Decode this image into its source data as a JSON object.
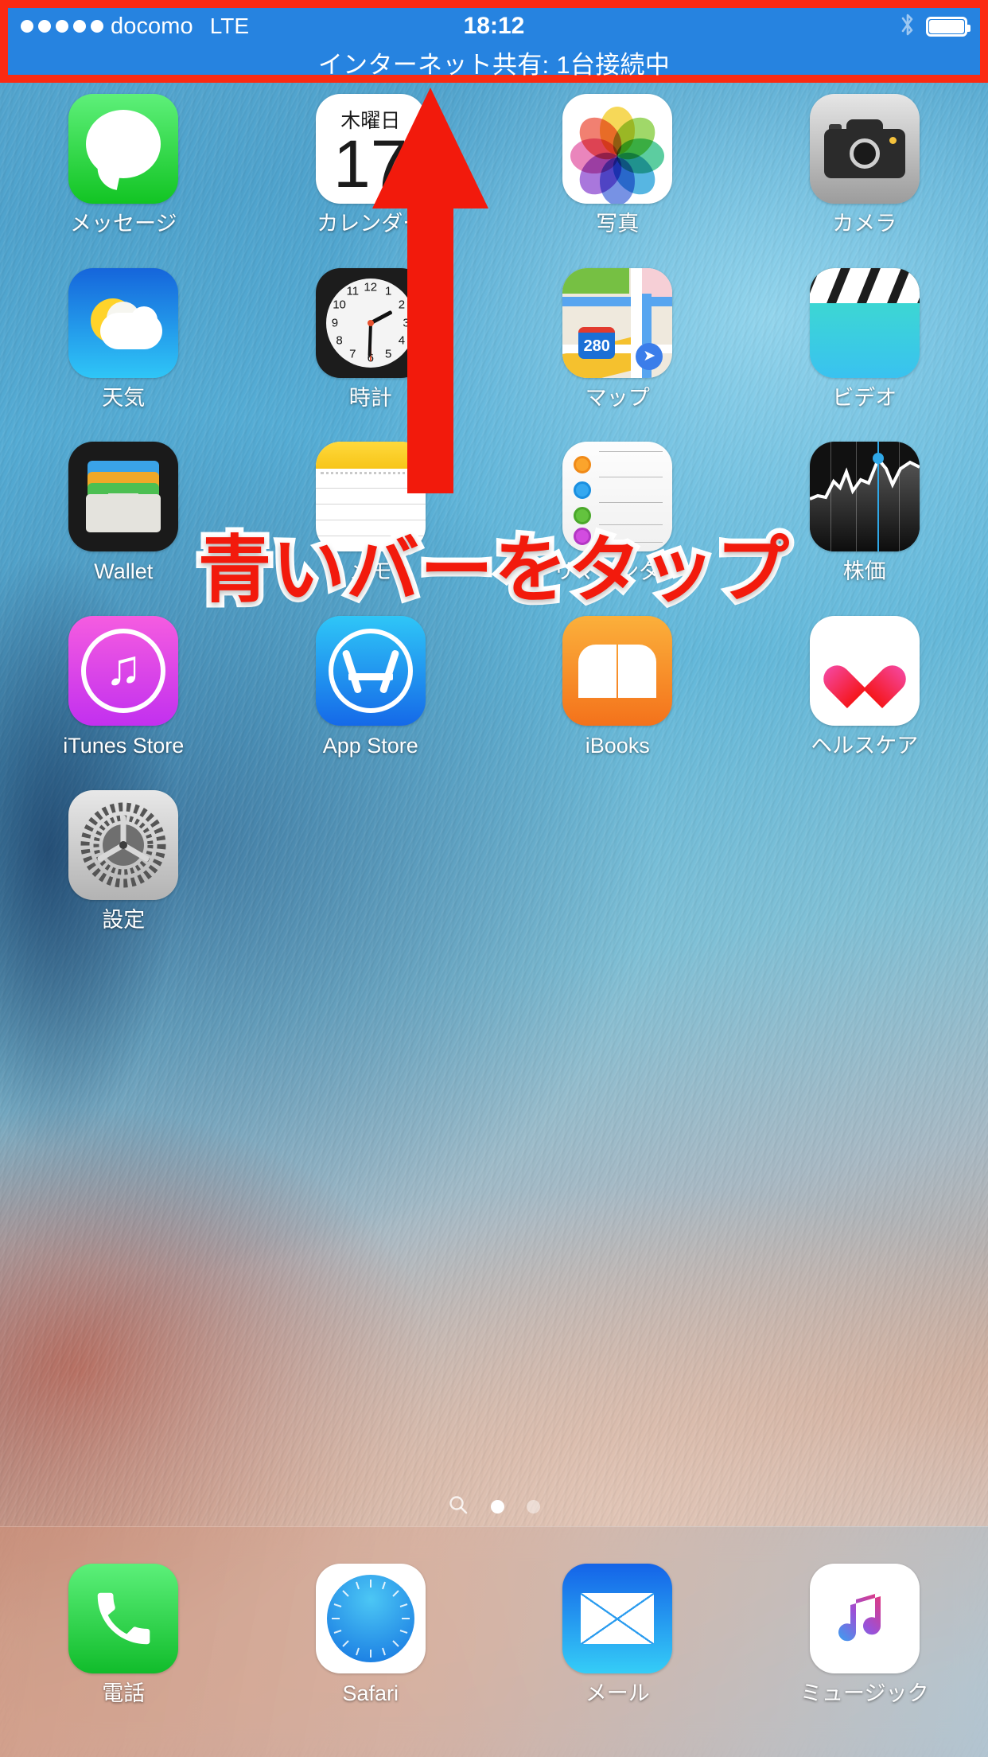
{
  "status_bar": {
    "carrier": "docomo",
    "network": "LTE",
    "signal_dots": 5,
    "time": "18:12",
    "bluetooth_icon": "bluetooth-icon",
    "battery_icon": "battery-full-icon",
    "hotspot_banner": "インターネット共有: 1台接続中",
    "bar_color": "#2683e0",
    "highlight_color": "#fb2a12"
  },
  "annotation": {
    "callout_text": "青いバーをタップ",
    "callout_color": "#f21a0c",
    "callout_outline": "#ffffff",
    "arrow_color": "#f21a0c",
    "arrow_name": "red-up-arrow"
  },
  "home_screen": {
    "rows": [
      [
        {
          "label": "メッセージ",
          "icon": "messages-icon",
          "name": "app-messages"
        },
        {
          "label": "カレンダー",
          "icon": "calendar-icon",
          "name": "app-calendar",
          "calendar_weekday": "木曜日",
          "calendar_day": "17"
        },
        {
          "label": "写真",
          "icon": "photos-icon",
          "name": "app-photos"
        },
        {
          "label": "カメラ",
          "icon": "camera-icon",
          "name": "app-camera"
        }
      ],
      [
        {
          "label": "天気",
          "icon": "weather-icon",
          "name": "app-weather"
        },
        {
          "label": "時計",
          "icon": "clock-icon",
          "name": "app-clock"
        },
        {
          "label": "マップ",
          "icon": "maps-icon",
          "name": "app-maps",
          "map_shield": "280"
        },
        {
          "label": "ビデオ",
          "icon": "videos-icon",
          "name": "app-videos"
        }
      ],
      [
        {
          "label": "Wallet",
          "icon": "wallet-icon",
          "name": "app-wallet"
        },
        {
          "label": "メモ",
          "icon": "notes-icon",
          "name": "app-notes"
        },
        {
          "label": "リマインダー",
          "icon": "reminders-icon",
          "name": "app-reminders"
        },
        {
          "label": "株価",
          "icon": "stocks-icon",
          "name": "app-stocks"
        }
      ],
      [
        {
          "label": "iTunes Store",
          "icon": "itunes-store-icon",
          "name": "app-itunes-store"
        },
        {
          "label": "App Store",
          "icon": "app-store-icon",
          "name": "app-app-store"
        },
        {
          "label": "iBooks",
          "icon": "ibooks-icon",
          "name": "app-ibooks"
        },
        {
          "label": "ヘルスケア",
          "icon": "health-icon",
          "name": "app-health"
        }
      ],
      [
        {
          "label": "設定",
          "icon": "settings-gear-icon",
          "name": "app-settings"
        },
        {
          "label": "",
          "icon": "",
          "name": "empty"
        },
        {
          "label": "",
          "icon": "",
          "name": "empty"
        },
        {
          "label": "",
          "icon": "",
          "name": "empty"
        }
      ]
    ]
  },
  "page_indicator": {
    "search_icon": "search-icon",
    "pages": 2,
    "active_page": 1
  },
  "dock": {
    "items": [
      {
        "label": "電話",
        "icon": "phone-icon",
        "name": "dock-phone"
      },
      {
        "label": "Safari",
        "icon": "safari-compass-icon",
        "name": "dock-safari"
      },
      {
        "label": "メール",
        "icon": "mail-envelope-icon",
        "name": "dock-mail"
      },
      {
        "label": "ミュージック",
        "icon": "music-note-icon",
        "name": "dock-music"
      }
    ]
  }
}
